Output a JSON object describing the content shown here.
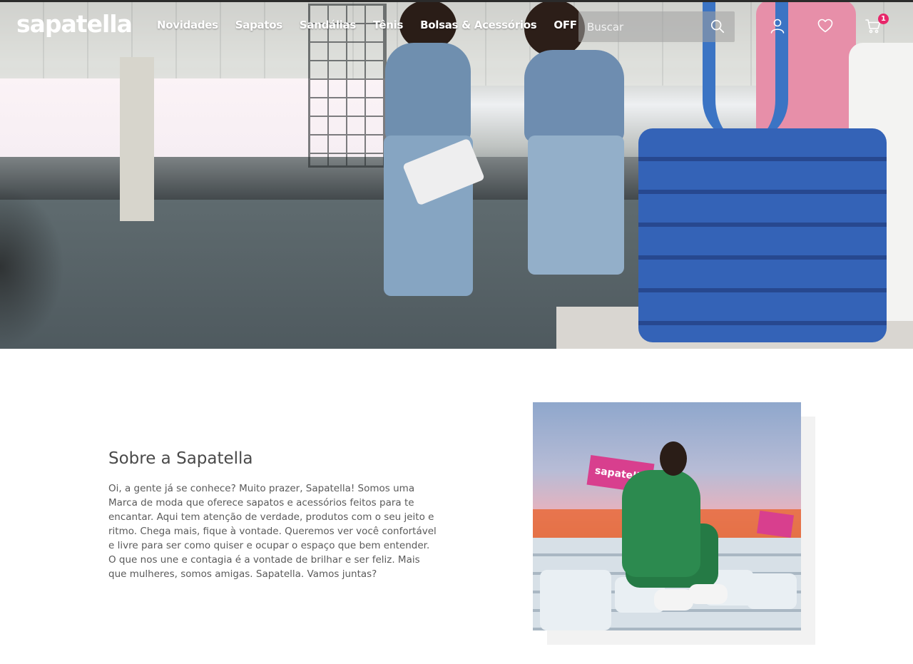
{
  "brand": {
    "logo_text": "sapatella"
  },
  "nav": {
    "items": [
      {
        "label": "Novidades"
      },
      {
        "label": "Sapatos"
      },
      {
        "label": "Sandálias"
      },
      {
        "label": "Tênis"
      },
      {
        "label": "Bolsas & Acessórios"
      },
      {
        "label": "OFF"
      }
    ]
  },
  "search": {
    "placeholder": "Buscar",
    "value": ""
  },
  "cart": {
    "count": "1"
  },
  "hero": {},
  "about": {
    "title": "Sobre a Sapatella",
    "text": "Oi, a gente já se conhece? Muito prazer, Sapatella! Somos uma Marca de moda que oferece sapatos e acessórios feitos para te encantar. Aqui tem atenção de verdade, produtos com o seu jeito e ritmo. Chega mais, fique à vontade. Queremos ver você confortável e livre para ser como quiser e ocupar o espaço que bem entender. O que nos une e contagia é a vontade de brilhar e ser feliz. Mais que mulheres, somos amigas. Sapatella. Vamos juntas?",
    "photo_sign_text": "sapatella"
  },
  "colors": {
    "badge": "#e8266a",
    "header_text": "#ffffff",
    "about_text": "#5a5a5a"
  },
  "icons": [
    "search-icon",
    "user-icon",
    "heart-icon",
    "cart-icon"
  ]
}
